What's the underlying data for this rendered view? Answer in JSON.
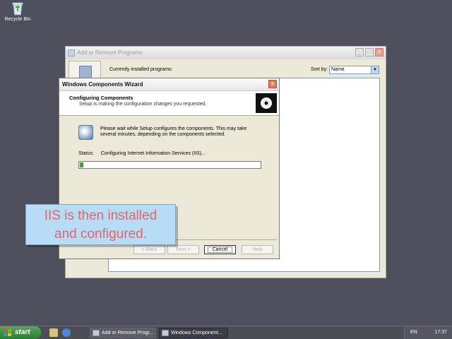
{
  "desktop": {
    "recycle_bin_label": "Recycle Bin"
  },
  "arp_window": {
    "title": "Add or Remove Programs",
    "currently_installed": "Currently installed programs:",
    "sort_by_label": "Sort by:",
    "sort_by_value": "Name"
  },
  "wizard": {
    "title": "Windows Components Wizard",
    "heading": "Configuring Components",
    "subheading": "Setup is making the configuration changes you requested.",
    "message": "Please wait while Setup configures the components. This may take several minutes, depending on the components selected.",
    "status_label": "Status:",
    "status_value": "Configuring Internet Information Services (IIS)...",
    "progress": 0.02,
    "back_label": "< Back",
    "next_label": "Next >",
    "cancel_label": "Cancel",
    "help_label": "Help"
  },
  "callout": {
    "line1": "IIS is then installed",
    "line2": "and configured."
  },
  "taskbar": {
    "start_label": "start",
    "tasks": [
      "Add or Remove Progr...",
      "Windows Component..."
    ],
    "language": "EN",
    "clock": "17:37"
  },
  "colors": {
    "desktop": "#4d4f5c",
    "progress": "#3ca52e",
    "callout_bg": "#b6dcf6",
    "callout_text": "#e7636a"
  }
}
